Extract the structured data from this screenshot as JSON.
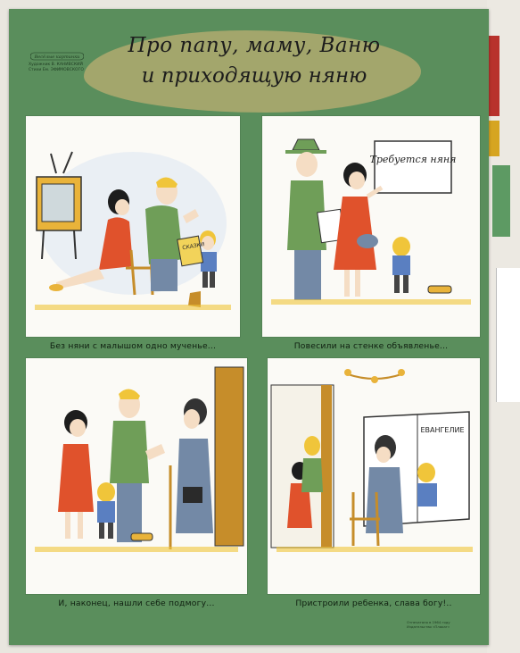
{
  "title": {
    "line1": "Про папу, маму, Ваню",
    "line2": "и приходящую няню"
  },
  "logo_text": "Весёлые картинки",
  "credits": [
    "Художник В. КАНИВСКИЙ",
    "Стихи Ем. ЭФИМОВСКОГО"
  ],
  "panels": [
    {
      "caption": "Без няни с малышом одно мученье...",
      "book_label": "СКАЗКИ"
    },
    {
      "caption": "Повесили на стенке объявленье...",
      "notice_text": "Требуется няня"
    },
    {
      "caption": "И, наконец, нашли себе подмогу..."
    },
    {
      "caption": "Пристроили ребенка, слава богу!..",
      "book_label": "ЕВАНГЕЛИЕ"
    }
  ],
  "imprint": [
    "Отпечатано в 1964 году",
    "Издательство «Плакат»"
  ],
  "colors": {
    "poster_green": "#5a8e5c",
    "title_blob": "#a3a66c",
    "dress_red": "#e0522c",
    "shirt_green": "#6f9e58",
    "yellow_hair": "#f0c53a"
  }
}
